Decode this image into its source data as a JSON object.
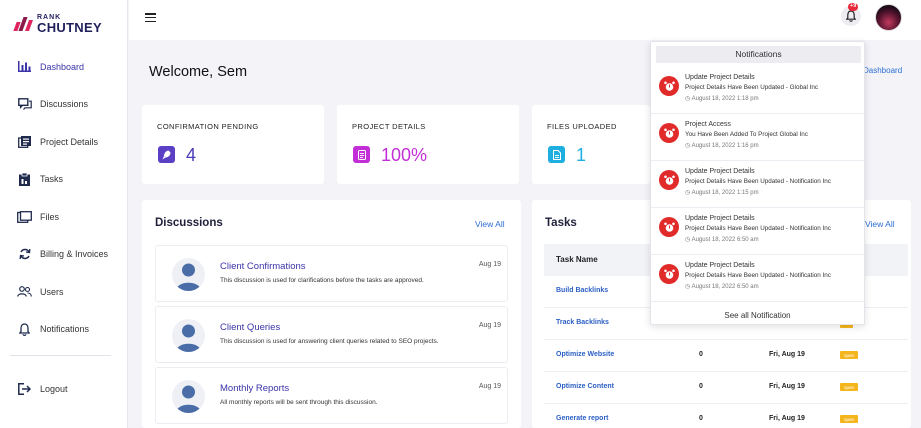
{
  "brand": {
    "line1": "RANK",
    "line2": "CHUTNEY",
    "color": "#e0245e"
  },
  "sidebar": {
    "items": [
      {
        "label": "Dashboard",
        "icon": "bar-chart-icon"
      },
      {
        "label": "Discussions",
        "icon": "chat-icon"
      },
      {
        "label": "Project Details",
        "icon": "list-icon"
      },
      {
        "label": "Tasks",
        "icon": "clipboard-icon"
      },
      {
        "label": "Files",
        "icon": "folder-icon"
      },
      {
        "label": "Billing & Invoices",
        "icon": "refresh-icon"
      },
      {
        "label": "Users",
        "icon": "users-icon"
      },
      {
        "label": "Notifications",
        "icon": "bell-icon"
      }
    ],
    "logout": "Logout"
  },
  "topbar": {
    "badge": "+9"
  },
  "welcome": "Welcome, Sem",
  "dashboard_link": "Dashboard",
  "stats": [
    {
      "title": "CONFIRMATION PENDING",
      "value": "4",
      "color": "#5b3fc4"
    },
    {
      "title": "PROJECT DETAILS",
      "value": "100%",
      "color": "#c22fd6"
    },
    {
      "title": "FILES UPLOADED",
      "value": "1",
      "color": "#1eaee0"
    }
  ],
  "discussions": {
    "title": "Discussions",
    "view_all": "View All",
    "items": [
      {
        "title": "Client Confirmations",
        "desc": "This discussion is used for clarifications before the tasks are approved.",
        "date": "Aug 19"
      },
      {
        "title": "Client Queries",
        "desc": "This discussion is used for answering client queries related to SEO projects.",
        "date": "Aug 19"
      },
      {
        "title": "Monthly Reports",
        "desc": "All monthly reports will be sent through this discussion.",
        "date": "Aug 19"
      }
    ]
  },
  "tasks": {
    "title": "Tasks",
    "view_all": "View All",
    "header": "Task Name",
    "rows": [
      {
        "name": "Build Backlinks"
      },
      {
        "name": "Track Backlinks"
      },
      {
        "name": "Optimize Website",
        "count": "0",
        "date": "Fri, Aug 19",
        "status": "open"
      },
      {
        "name": "Optimize Content",
        "count": "0",
        "date": "Fri, Aug 19",
        "status": "open"
      },
      {
        "name": "Generate report",
        "count": "0",
        "date": "Fri, Aug 19",
        "status": "open"
      }
    ]
  },
  "notifications": {
    "title": "Notifications",
    "footer": "See all Notification",
    "items": [
      {
        "title": "Update Project Details",
        "sub": "Project Details Have Been Updated - Global Inc",
        "date": "August 18, 2022 1:18 pm"
      },
      {
        "title": "Project Access",
        "sub": "You Have Been Added To Project Global Inc",
        "date": "August 18, 2022 1:16 pm"
      },
      {
        "title": "Update Project Details",
        "sub": "Project Details Have Been Updated - Notification Inc",
        "date": "August 18, 2022 1:15 pm"
      },
      {
        "title": "Update Project Details",
        "sub": "Project Details Have Been Updated - Notification Inc",
        "date": "August 18, 2022 6:50 am"
      },
      {
        "title": "Update Project Details",
        "sub": "Project Details Have Been Updated - Notification Inc",
        "date": "August 18, 2022 6:50 am"
      }
    ]
  }
}
